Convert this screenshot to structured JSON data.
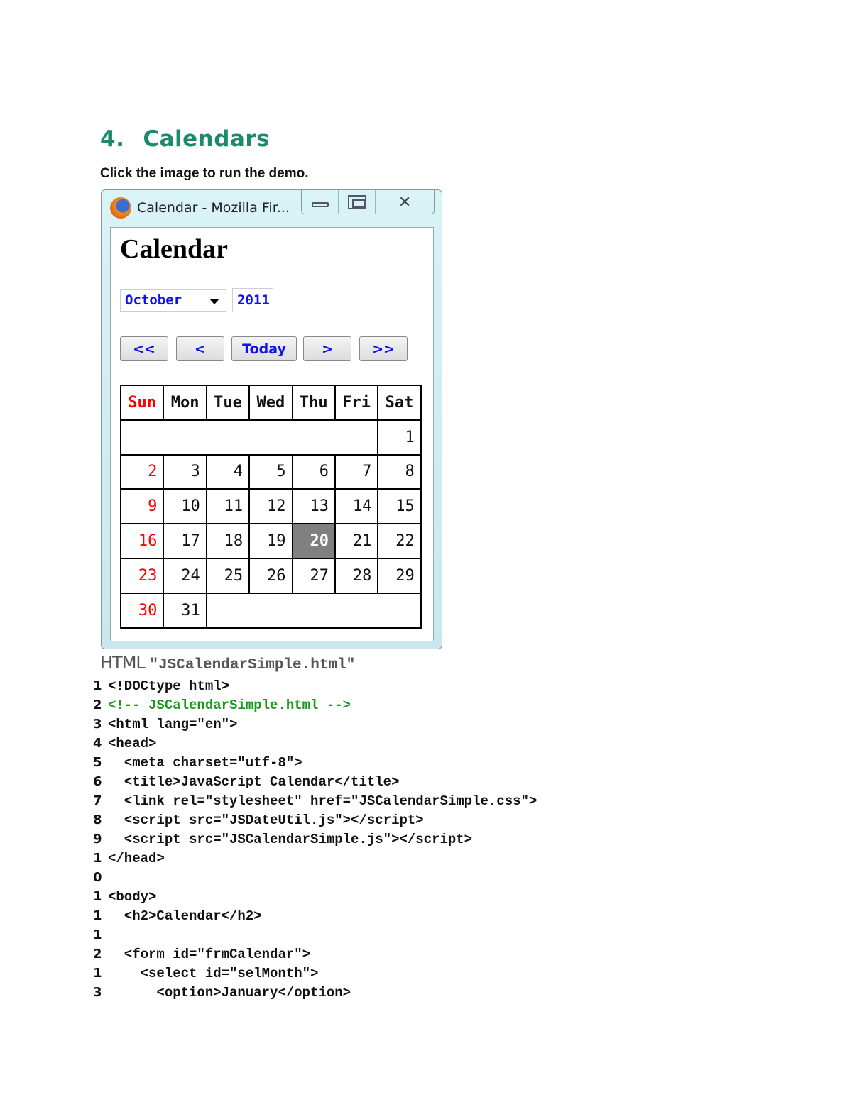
{
  "heading": {
    "number": "4.",
    "title": "Calendars"
  },
  "intro": "Click the image to run the demo.",
  "window": {
    "title": "Calendar - Mozilla Fir...",
    "icon": "firefox-icon",
    "controls": [
      "minimize-icon",
      "maximize-icon",
      "close-icon"
    ],
    "page_title": "Calendar",
    "month": "October",
    "year": "2011",
    "buttons": [
      "<<",
      "<",
      "Today",
      ">",
      ">>"
    ],
    "days": [
      "Sun",
      "Mon",
      "Tue",
      "Wed",
      "Thu",
      "Fri",
      "Sat"
    ],
    "weeks": [
      [
        "",
        "",
        "",
        "",
        "",
        "",
        "1"
      ],
      [
        "2",
        "3",
        "4",
        "5",
        "6",
        "7",
        "8"
      ],
      [
        "9",
        "10",
        "11",
        "12",
        "13",
        "14",
        "15"
      ],
      [
        "16",
        "17",
        "18",
        "19",
        "20",
        "21",
        "22"
      ],
      [
        "23",
        "24",
        "25",
        "26",
        "27",
        "28",
        "29"
      ],
      [
        "30",
        "31",
        "",
        "",
        "",
        "",
        ""
      ]
    ],
    "today": "20",
    "sunday_color": "#ff0000",
    "link_color": "#1010ee"
  },
  "caption": {
    "prefix": "HTML ",
    "file": "\"JSCalendarSimple.html\""
  },
  "code": [
    {
      "num": "1",
      "text": "<!DOCtype html>"
    },
    {
      "num": "2",
      "text": "<!-- JSCalendarSimple.html -->",
      "comment": true
    },
    {
      "num": "3",
      "text": "<html lang=\"en\">"
    },
    {
      "num": "4",
      "text": "<head>"
    },
    {
      "num": "5",
      "text": "  <meta charset=\"utf-8\">"
    },
    {
      "num": "6",
      "text": "  <title>JavaScript Calendar</title>"
    },
    {
      "num": "7",
      "text": "  <link rel=\"stylesheet\" href=\"JSCalendarSimple.css\">"
    },
    {
      "num": "8",
      "text": "  <script src=\"JSDateUtil.js\"></script>"
    },
    {
      "num": "9",
      "text": "  <script src=\"JSCalendarSimple.js\"></script>"
    },
    {
      "num": "1",
      "text": "</head>"
    },
    {
      "num": "0",
      "text": ""
    },
    {
      "num": "1",
      "text": "<body>"
    },
    {
      "num": "1",
      "text": "  <h2>Calendar</h2>"
    },
    {
      "num": "1",
      "text": ""
    },
    {
      "num": "2",
      "text": "  <form id=\"frmCalendar\">"
    },
    {
      "num": "1",
      "text": "    <select id=\"selMonth\">"
    },
    {
      "num": "3",
      "text": "      <option>January</option>"
    }
  ]
}
